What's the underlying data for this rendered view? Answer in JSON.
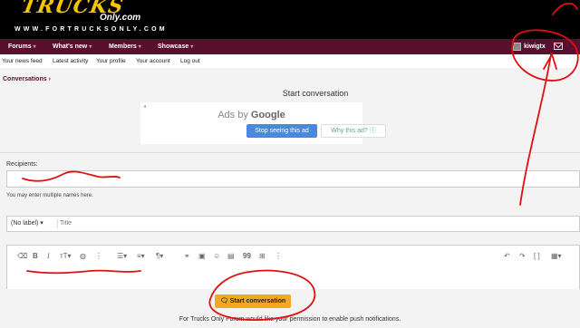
{
  "header": {
    "logo_main": "TRUCKS",
    "logo_only": "Only.com",
    "logo_url": "WWW.FORTRUCKSONLY.COM"
  },
  "nav": {
    "items": [
      {
        "label": "Forums"
      },
      {
        "label": "What's new"
      },
      {
        "label": "Members"
      },
      {
        "label": "Showcase"
      }
    ],
    "username": "kiwigtx"
  },
  "subnav": {
    "items": [
      "Your news feed",
      "Latest activity",
      "Your profile",
      "Your account",
      "Log out"
    ]
  },
  "breadcrumb": "Conversations ›",
  "page_title": "Start conversation",
  "ad": {
    "title_prefix": "Ads by ",
    "title_brand": "Google",
    "stop_label": "Stop seeing this ad",
    "why_label": "Why this ad? ⓘ"
  },
  "form": {
    "recipients_label": "Recipients:",
    "recipients_hint": "You may enter multiple names here.",
    "prefix_value": "(No label) ▾",
    "title_placeholder": "Title",
    "submit_label": "Start conversation"
  },
  "toolbar": {
    "icons": [
      "eraser-icon",
      "bold-icon",
      "italic-icon",
      "text-size-icon",
      "palette-icon",
      "more-vertical-icon",
      "list-icon",
      "align-icon",
      "paragraph-icon",
      "link-icon",
      "image-icon",
      "smilie-icon",
      "media-icon",
      "quote-icon",
      "table-icon",
      "more-vertical-icon",
      "undo-icon",
      "redo-icon",
      "code-icon",
      "preview-icon"
    ]
  },
  "push_notice": "For Trucks Only Forum would like your permission to enable push notifications.",
  "colors": {
    "nav_bg": "#5a0f2e",
    "logo_yellow": "#f5c400",
    "submit_bg": "#f5a623",
    "ad_button": "#4a88e0",
    "annotation_red": "#e01010"
  }
}
